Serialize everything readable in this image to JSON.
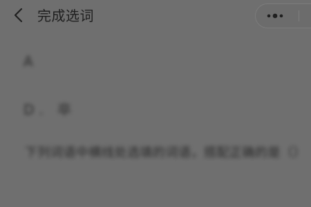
{
  "header": {
    "back_icon": "chevron-left-icon",
    "title": "完成选词",
    "more_icon": "three-dots-icon"
  },
  "content": {
    "line1": "A",
    "line2": "D. 卒",
    "line3": "下列词语中横线处选填的词语，搭配正确的是（）"
  }
}
